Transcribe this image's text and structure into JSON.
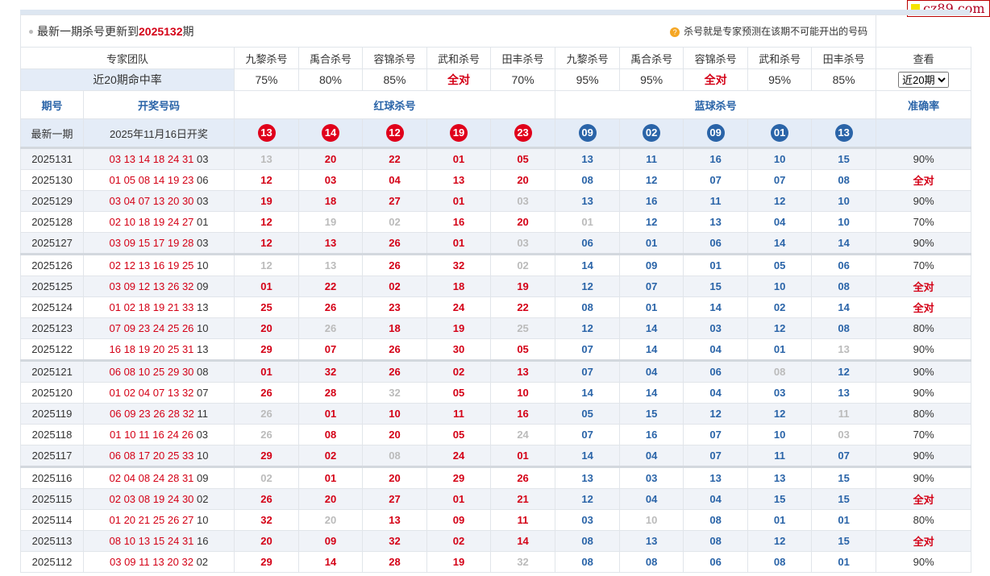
{
  "logo": "cz89.com",
  "title": {
    "prefix": "最新一期杀号更新到",
    "period": "2025132",
    "suffix": "期",
    "hint": "杀号就是专家预测在该期不可能开出的号码"
  },
  "experts": {
    "label": "专家团队",
    "names": [
      "九黎杀号",
      "禹合杀号",
      "容锦杀号",
      "武和杀号",
      "田丰杀号",
      "九黎杀号",
      "禹合杀号",
      "容锦杀号",
      "武和杀号",
      "田丰杀号"
    ],
    "view_label": "查看"
  },
  "rates": {
    "label": "近20期命中率",
    "values": [
      "75%",
      "80%",
      "85%",
      "全对",
      "70%",
      "95%",
      "95%",
      "全对",
      "95%",
      "85%"
    ],
    "select_value": "近20期"
  },
  "headers": {
    "period": "期号",
    "draw": "开奖号码",
    "red_kill": "红球杀号",
    "blue_kill": "蓝球杀号",
    "accuracy": "准确率"
  },
  "latest": {
    "label": "最新一期",
    "date": "2025年11月16日开奖",
    "red": [
      "13",
      "14",
      "12",
      "19",
      "23"
    ],
    "blue": [
      "09",
      "02",
      "09",
      "01",
      "13"
    ]
  },
  "rows": [
    {
      "period": "2025131",
      "draw": [
        "03",
        "13",
        "14",
        "18",
        "24",
        "31",
        "03"
      ],
      "red": [
        "13",
        "20",
        "22",
        "01",
        "05"
      ],
      "blue": [
        "13",
        "11",
        "16",
        "10",
        "15"
      ],
      "acc": "90%"
    },
    {
      "period": "2025130",
      "draw": [
        "01",
        "05",
        "08",
        "14",
        "19",
        "23",
        "06"
      ],
      "red": [
        "12",
        "03",
        "04",
        "13",
        "20"
      ],
      "blue": [
        "08",
        "12",
        "07",
        "07",
        "08"
      ],
      "acc": "全对"
    },
    {
      "period": "2025129",
      "draw": [
        "03",
        "04",
        "07",
        "13",
        "20",
        "30",
        "03"
      ],
      "red": [
        "19",
        "18",
        "27",
        "01",
        "03"
      ],
      "blue": [
        "13",
        "16",
        "11",
        "12",
        "10"
      ],
      "acc": "90%"
    },
    {
      "period": "2025128",
      "draw": [
        "02",
        "10",
        "18",
        "19",
        "24",
        "27",
        "01"
      ],
      "red": [
        "12",
        "19",
        "02",
        "16",
        "20"
      ],
      "blue": [
        "01",
        "12",
        "13",
        "04",
        "10"
      ],
      "acc": "70%"
    },
    {
      "period": "2025127",
      "draw": [
        "03",
        "09",
        "15",
        "17",
        "19",
        "28",
        "03"
      ],
      "red": [
        "12",
        "13",
        "26",
        "01",
        "03"
      ],
      "blue": [
        "06",
        "01",
        "06",
        "14",
        "14"
      ],
      "acc": "90%"
    },
    {
      "period": "2025126",
      "draw": [
        "02",
        "12",
        "13",
        "16",
        "19",
        "25",
        "10"
      ],
      "red": [
        "12",
        "13",
        "26",
        "32",
        "02"
      ],
      "blue": [
        "14",
        "09",
        "01",
        "05",
        "06"
      ],
      "acc": "70%"
    },
    {
      "period": "2025125",
      "draw": [
        "03",
        "09",
        "12",
        "13",
        "26",
        "32",
        "09"
      ],
      "red": [
        "01",
        "22",
        "02",
        "18",
        "19"
      ],
      "blue": [
        "12",
        "07",
        "15",
        "10",
        "08"
      ],
      "acc": "全对"
    },
    {
      "period": "2025124",
      "draw": [
        "01",
        "02",
        "18",
        "19",
        "21",
        "33",
        "13"
      ],
      "red": [
        "25",
        "26",
        "23",
        "24",
        "22"
      ],
      "blue": [
        "08",
        "01",
        "14",
        "02",
        "14"
      ],
      "acc": "全对"
    },
    {
      "period": "2025123",
      "draw": [
        "07",
        "09",
        "23",
        "24",
        "25",
        "26",
        "10"
      ],
      "red": [
        "20",
        "26",
        "18",
        "19",
        "25"
      ],
      "blue": [
        "12",
        "14",
        "03",
        "12",
        "08"
      ],
      "acc": "80%"
    },
    {
      "period": "2025122",
      "draw": [
        "16",
        "18",
        "19",
        "20",
        "25",
        "31",
        "13"
      ],
      "red": [
        "29",
        "07",
        "26",
        "30",
        "05"
      ],
      "blue": [
        "07",
        "14",
        "04",
        "01",
        "13"
      ],
      "acc": "90%"
    },
    {
      "period": "2025121",
      "draw": [
        "06",
        "08",
        "10",
        "25",
        "29",
        "30",
        "08"
      ],
      "red": [
        "01",
        "32",
        "26",
        "02",
        "13"
      ],
      "blue": [
        "07",
        "04",
        "06",
        "08",
        "12"
      ],
      "acc": "90%"
    },
    {
      "period": "2025120",
      "draw": [
        "01",
        "02",
        "04",
        "07",
        "13",
        "32",
        "07"
      ],
      "red": [
        "26",
        "28",
        "32",
        "05",
        "10"
      ],
      "blue": [
        "14",
        "14",
        "04",
        "03",
        "13"
      ],
      "acc": "90%"
    },
    {
      "period": "2025119",
      "draw": [
        "06",
        "09",
        "23",
        "26",
        "28",
        "32",
        "11"
      ],
      "red": [
        "26",
        "01",
        "10",
        "11",
        "16"
      ],
      "blue": [
        "05",
        "15",
        "12",
        "12",
        "11"
      ],
      "acc": "80%"
    },
    {
      "period": "2025118",
      "draw": [
        "01",
        "10",
        "11",
        "16",
        "24",
        "26",
        "03"
      ],
      "red": [
        "26",
        "08",
        "20",
        "05",
        "24"
      ],
      "blue": [
        "07",
        "16",
        "07",
        "10",
        "03"
      ],
      "acc": "70%"
    },
    {
      "period": "2025117",
      "draw": [
        "06",
        "08",
        "17",
        "20",
        "25",
        "33",
        "10"
      ],
      "red": [
        "29",
        "02",
        "08",
        "24",
        "01"
      ],
      "blue": [
        "14",
        "04",
        "07",
        "11",
        "07"
      ],
      "acc": "90%"
    },
    {
      "period": "2025116",
      "draw": [
        "02",
        "04",
        "08",
        "24",
        "28",
        "31",
        "09"
      ],
      "red": [
        "02",
        "01",
        "20",
        "29",
        "26"
      ],
      "blue": [
        "13",
        "03",
        "13",
        "13",
        "15"
      ],
      "acc": "90%"
    },
    {
      "period": "2025115",
      "draw": [
        "02",
        "03",
        "08",
        "19",
        "24",
        "30",
        "02"
      ],
      "red": [
        "26",
        "20",
        "27",
        "01",
        "21"
      ],
      "blue": [
        "12",
        "04",
        "04",
        "15",
        "15"
      ],
      "acc": "全对"
    },
    {
      "period": "2025114",
      "draw": [
        "01",
        "20",
        "21",
        "25",
        "26",
        "27",
        "10"
      ],
      "red": [
        "32",
        "20",
        "13",
        "09",
        "11"
      ],
      "blue": [
        "03",
        "10",
        "08",
        "01",
        "01"
      ],
      "acc": "80%"
    },
    {
      "period": "2025113",
      "draw": [
        "08",
        "10",
        "13",
        "15",
        "24",
        "31",
        "16"
      ],
      "red": [
        "20",
        "09",
        "32",
        "02",
        "14"
      ],
      "blue": [
        "08",
        "13",
        "08",
        "12",
        "15"
      ],
      "acc": "全对"
    },
    {
      "period": "2025112",
      "draw": [
        "03",
        "09",
        "11",
        "13",
        "20",
        "32",
        "02"
      ],
      "red": [
        "29",
        "14",
        "28",
        "19",
        "32"
      ],
      "blue": [
        "08",
        "08",
        "06",
        "08",
        "01"
      ],
      "acc": "90%"
    }
  ],
  "colors": {
    "red": "#d40016",
    "blue": "#2a64a8",
    "hit": "#bbbbbb",
    "row_alt": "#f0f3f8"
  }
}
